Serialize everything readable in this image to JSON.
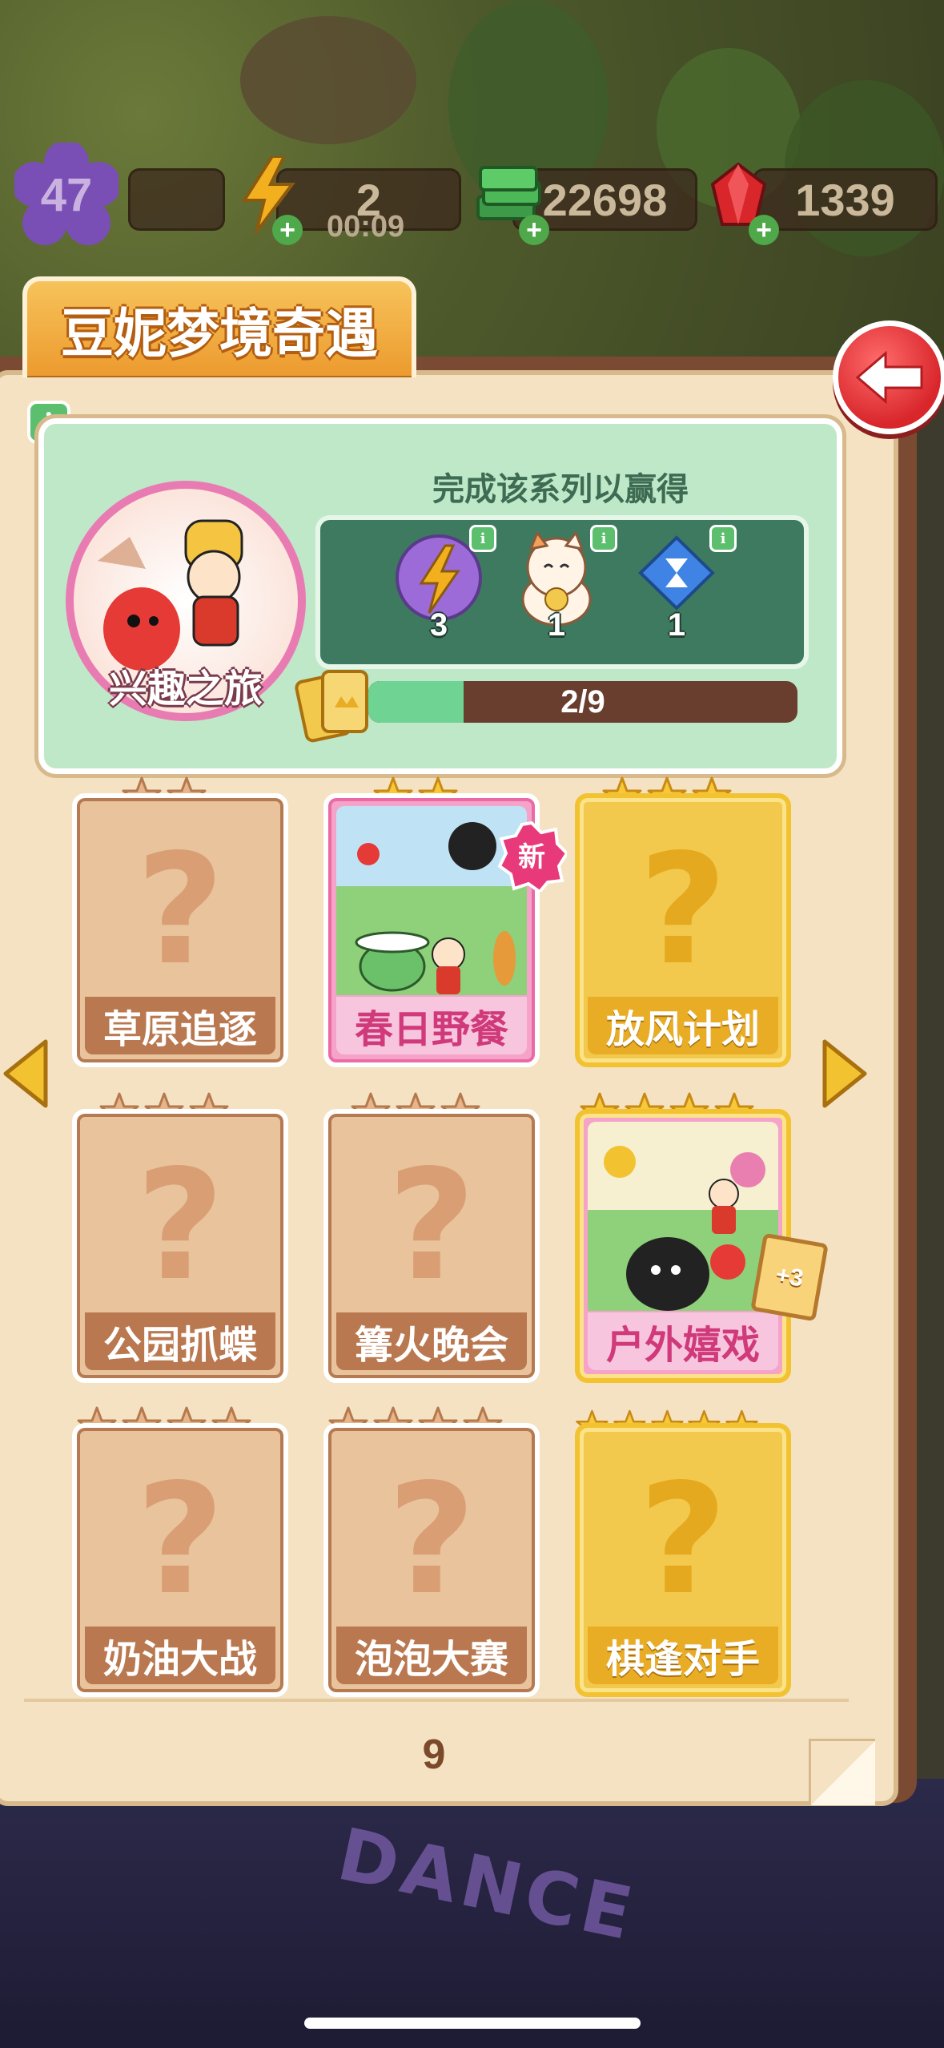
{
  "hud": {
    "level": "47",
    "energy": "2",
    "energy_timer": "00:09",
    "cash": "22698",
    "gems": "1339"
  },
  "title": "豆妮梦境奇遇",
  "series": {
    "name": "兴趣之旅",
    "reward_title": "完成该系列以赢得",
    "rewards": [
      {
        "icon": "energy-orb-icon",
        "count": "3"
      },
      {
        "icon": "lucky-cat-icon",
        "count": "1"
      },
      {
        "icon": "hourglass-gem-icon",
        "count": "1"
      }
    ],
    "progress_text": "2/9",
    "progress_fraction": 0.222
  },
  "cards": [
    {
      "label": "草原追逐",
      "stars": 2,
      "state": "locked"
    },
    {
      "label": "春日野餐",
      "stars": 2,
      "state": "owned",
      "badge": "新"
    },
    {
      "label": "放风计划",
      "stars": 3,
      "state": "gold-locked"
    },
    {
      "label": "公园抓蝶",
      "stars": 3,
      "state": "locked"
    },
    {
      "label": "篝火晚会",
      "stars": 3,
      "state": "locked"
    },
    {
      "label": "户外嬉戏",
      "stars": 4,
      "state": "gold-owned",
      "badge": "+3"
    },
    {
      "label": "奶油大战",
      "stars": 4,
      "state": "locked"
    },
    {
      "label": "泡泡大赛",
      "stars": 4,
      "state": "locked"
    },
    {
      "label": "棋逢对手",
      "stars": 5,
      "state": "gold-locked"
    }
  ],
  "page_number": "9",
  "background_sign": "DANCE",
  "colors": {
    "accent_orange": "#ec9a2e",
    "panel_green": "#bfe8c8",
    "locked_card": "#e8c39c",
    "gold_card": "#f2c94c",
    "pink_card": "#f5a3c8",
    "back_red": "#d8262b"
  }
}
